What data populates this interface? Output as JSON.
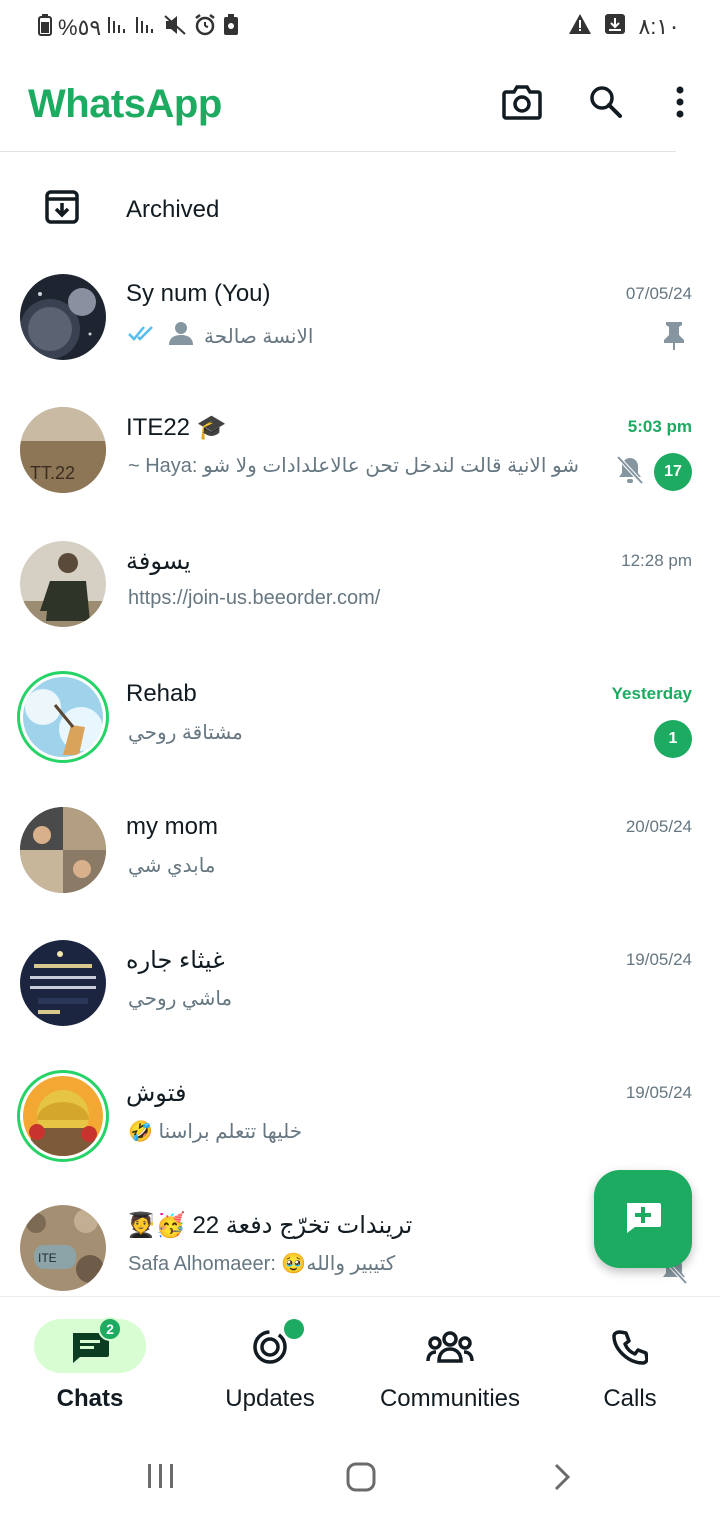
{
  "status_bar": {
    "left_text": "%٥٩",
    "time": "٨:١٠"
  },
  "app": {
    "title": "WhatsApp",
    "brand_color": "#1daa61"
  },
  "archived": {
    "label": "Archived"
  },
  "chats": [
    {
      "name": "Sy num (You)",
      "time": "07/05/24",
      "preview": "الانسة صالحة",
      "pinned": true,
      "read_ticks": true
    },
    {
      "name": "ITE22 🎓",
      "time": "5:03 pm",
      "preview": "~ Haya: شو الانية قالت لندخل تحن عالاعلدادات ولا شو",
      "unread": "17",
      "muted": true
    },
    {
      "name": "يسوفة",
      "time": "12:28 pm",
      "preview": "https://join-us.beeorder.com/"
    },
    {
      "name": "Rehab",
      "time": "Yesterday",
      "preview": "مشتاقة روحي",
      "unread": "1",
      "status_ring": true
    },
    {
      "name": "my mom",
      "time": "20/05/24",
      "preview": "مابدي شي"
    },
    {
      "name": "غيثاء جاره",
      "time": "19/05/24",
      "preview": "ماشي روحي"
    },
    {
      "name": "فتوش",
      "time": "19/05/24",
      "preview": "🤣 خليها تتعلم براسنا",
      "status_ring": true
    },
    {
      "name": "🧑‍🎓🥳 تريندات تخرّج دفعة 22",
      "time": "",
      "preview": "Safa Alhomaeer: 🥹كتيبير والله",
      "muted": true
    }
  ],
  "bottom_nav": {
    "chats": {
      "label": "Chats",
      "badge": "2"
    },
    "updates": {
      "label": "Updates"
    },
    "communities": {
      "label": "Communities"
    },
    "calls": {
      "label": "Calls"
    }
  }
}
